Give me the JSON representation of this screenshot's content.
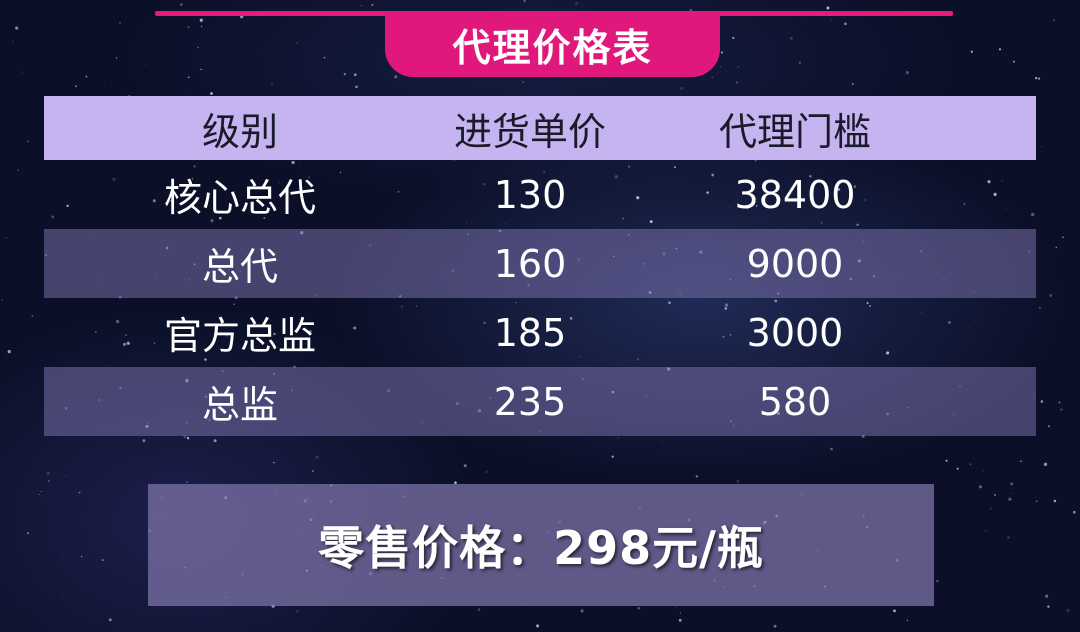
{
  "title": "代理价格表",
  "table": {
    "headers": [
      "级别",
      "进货单价",
      "代理门槛"
    ],
    "rows": [
      [
        "核心总代",
        "130",
        "38400"
      ],
      [
        "总代",
        "160",
        "9000"
      ],
      [
        "官方总监",
        "185",
        "3000"
      ],
      [
        "总监",
        "235",
        "580"
      ]
    ]
  },
  "retail": "零售价格：298元/瓶",
  "colors": {
    "accent": "#e0187c",
    "header_bg": "#c5b4f0",
    "background": "#0b1028"
  }
}
